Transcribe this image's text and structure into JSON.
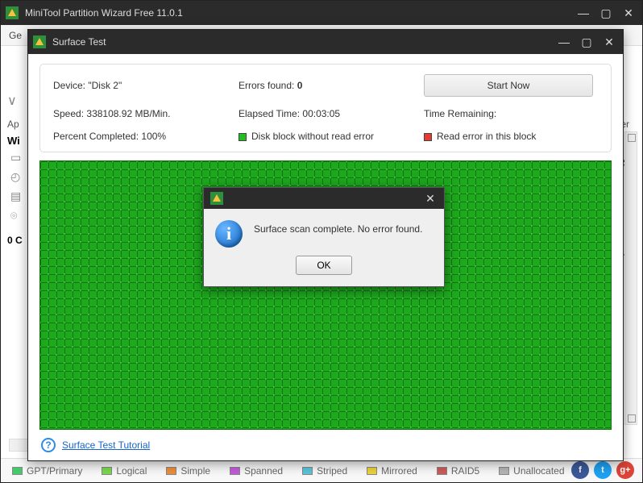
{
  "main": {
    "title": "MiniTool Partition Wizard Free 11.0.1",
    "menubar": {
      "item0": "Ge"
    },
    "wizards_label": "Wi",
    "oc_label": "0 C",
    "right_col": {
      "ster": "ster",
      "es": "e S",
      "un": "Un"
    }
  },
  "surface": {
    "title": "Surface Test",
    "device_label": "Device:",
    "device_value": "\"Disk 2\"",
    "errors_label": "Errors found:",
    "errors_value": "0",
    "start_btn": "Start Now",
    "speed_label": "Speed:",
    "speed_value": "338108.92 MB/Min.",
    "elapsed_label": "Elapsed Time:",
    "elapsed_value": "00:03:05",
    "remaining_label": "Time Remaining:",
    "remaining_value": "",
    "percent_label": "Percent Completed:",
    "percent_value": "100%",
    "legend_ok": "Disk block without read error",
    "legend_err": "Read error in this block",
    "tutorial": "Surface Test Tutorial"
  },
  "alert": {
    "message": "Surface scan complete. No error found.",
    "ok": "OK"
  },
  "legend": {
    "gpt": "GPT/Primary",
    "logical": "Logical",
    "simple": "Simple",
    "spanned": "Spanned",
    "striped": "Striped",
    "mirrored": "Mirrored",
    "raid5": "RAID5",
    "unalloc": "Unallocated"
  },
  "legend_colors": {
    "gpt": "#45c96c",
    "logical": "#7ad850",
    "simple": "#e98f3a",
    "spanned": "#c45bd9",
    "striped": "#5bc3d9",
    "mirrored": "#e9d33a",
    "raid5": "#cc5b5b",
    "unalloc": "#b5b5b5"
  }
}
